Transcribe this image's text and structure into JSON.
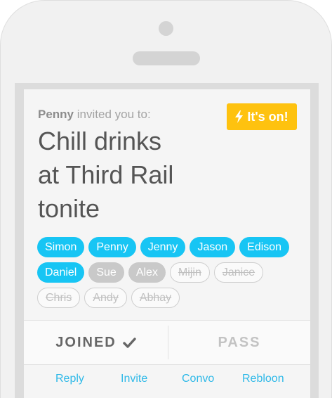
{
  "invite": {
    "inviter": "Penny",
    "invited_text": "invited you to:",
    "status_badge": "It's on!",
    "title_line1": "Chill drinks",
    "title_line2": "at Third Rail",
    "title_line3": "tonite"
  },
  "attendees": [
    {
      "name": "Simon",
      "status": "joined"
    },
    {
      "name": "Penny",
      "status": "joined"
    },
    {
      "name": "Jenny",
      "status": "joined"
    },
    {
      "name": "Jason",
      "status": "joined"
    },
    {
      "name": "Edison",
      "status": "joined"
    },
    {
      "name": "Daniel",
      "status": "joined"
    },
    {
      "name": "Sue",
      "status": "maybe"
    },
    {
      "name": "Alex",
      "status": "maybe"
    },
    {
      "name": "Mijin",
      "status": "declined"
    },
    {
      "name": "Janice",
      "status": "declined"
    },
    {
      "name": "Chris",
      "status": "declined"
    },
    {
      "name": "Andy",
      "status": "declined"
    },
    {
      "name": "Abhay",
      "status": "declined"
    }
  ],
  "actions": {
    "joined_label": "JOINED",
    "pass_label": "PASS"
  },
  "tabs": {
    "reply": "Reply",
    "invite": "Invite",
    "convo": "Convo",
    "rebloon": "Rebloon"
  },
  "colors": {
    "joined_chip": "#17c5f4",
    "maybe_chip": "#c9c9c9",
    "badge": "#fec20f",
    "tab_link": "#2fb9e8"
  },
  "icons": {
    "badge_icon": "lightning-bolt-icon",
    "joined_icon": "checkmark-icon"
  }
}
